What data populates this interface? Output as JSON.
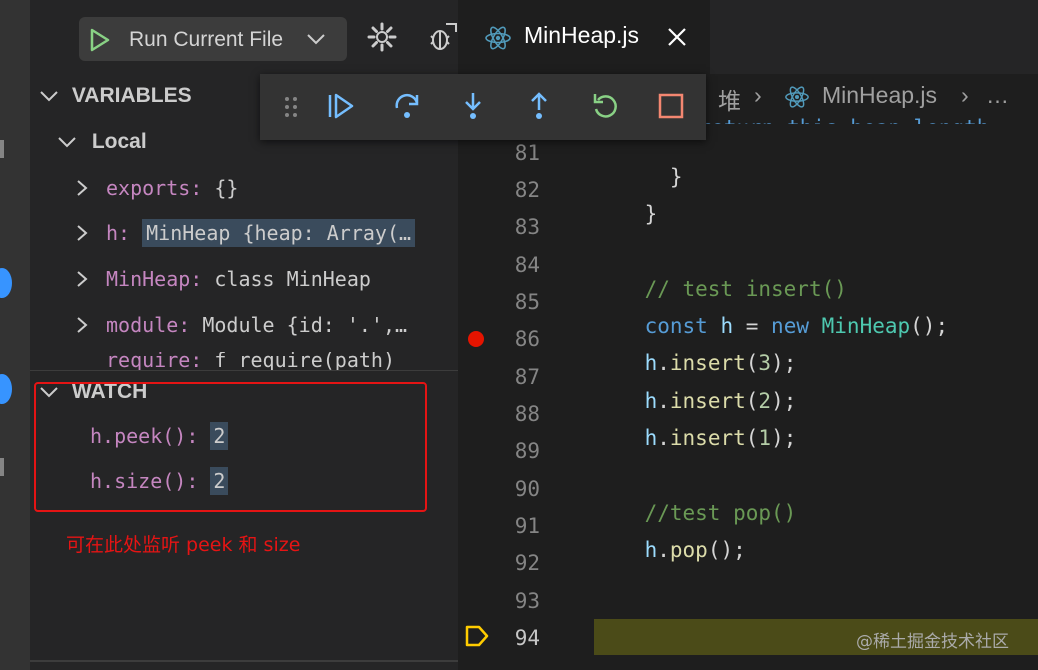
{
  "colors": {
    "accent_blue": "#3794ff",
    "play_green": "#89d185",
    "annotation_red": "#e51414",
    "breakpoint_red": "#e51400",
    "current_line": "#4b4b18",
    "stop_orange": "#f48771"
  },
  "run_config": {
    "label": "Run Current File"
  },
  "icons": {
    "play": "play-icon",
    "gear": "gear-icon",
    "debug": "debug-console-icon",
    "react": "react-icon",
    "close": "close-icon"
  },
  "variables": {
    "title": "VARIABLES",
    "scope": "Local",
    "items": [
      {
        "name": "exports:",
        "value": "{}"
      },
      {
        "name": "h:",
        "value": "MinHeap {heap: Array(…"
      },
      {
        "name": "MinHeap:",
        "value": "class MinHeap"
      },
      {
        "name": "module:",
        "value": "Module {id: '.',…"
      },
      {
        "name": "require:",
        "value": "f require(path)"
      }
    ]
  },
  "watch": {
    "title": "WATCH",
    "items": [
      {
        "expr": "h.peek():",
        "value": "2"
      },
      {
        "expr": "h.size():",
        "value": "2"
      }
    ],
    "annotation": "可在此处监听 peek 和 size"
  },
  "editor": {
    "tab_label": "MinHeap.js",
    "breadcrumb": [
      "堆",
      "MinHeap.js",
      "…"
    ],
    "partial_line": "return this.heap.length",
    "lines": [
      {
        "num": "81",
        "text": "  }"
      },
      {
        "num": "82",
        "text": "}"
      },
      {
        "num": "83",
        "text": ""
      },
      {
        "num": "84",
        "text": "// test insert()"
      },
      {
        "num": "85",
        "text": "const h = new MinHeap();"
      },
      {
        "num": "86",
        "text": "h.insert(3);"
      },
      {
        "num": "87",
        "text": "h.insert(2);"
      },
      {
        "num": "88",
        "text": "h.insert(1);"
      },
      {
        "num": "89",
        "text": ""
      },
      {
        "num": "90",
        "text": "//test pop()"
      },
      {
        "num": "91",
        "text": "h.pop();"
      },
      {
        "num": "92",
        "text": ""
      },
      {
        "num": "93",
        "text": ""
      },
      {
        "num": "94",
        "text": ""
      }
    ]
  },
  "debug_toolbar": {
    "buttons": [
      "continue",
      "step-over",
      "step-into",
      "step-out",
      "restart",
      "stop"
    ]
  },
  "watermark": "@稀土掘金技术社区"
}
